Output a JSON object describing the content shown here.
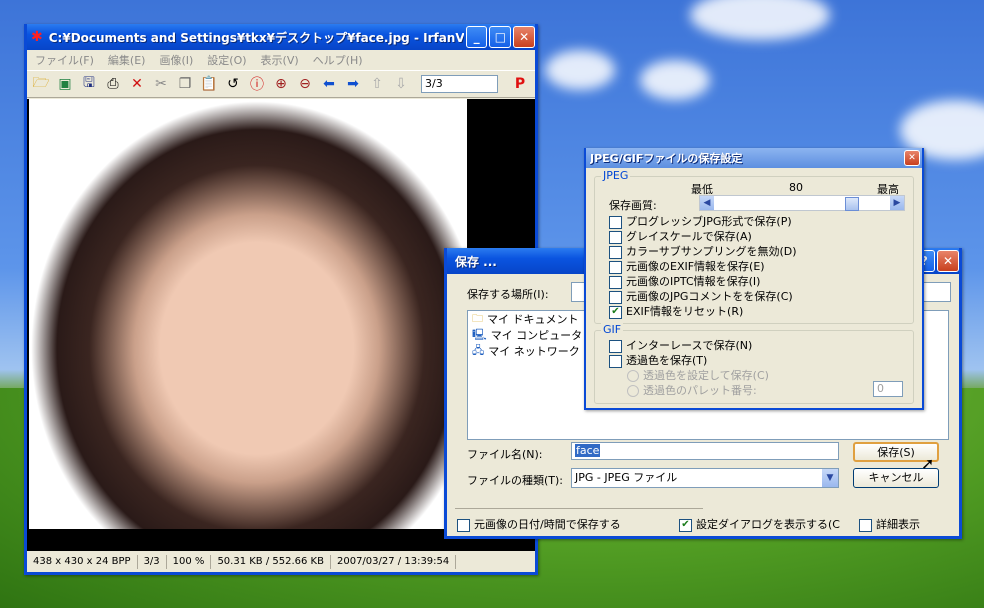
{
  "irfanview": {
    "title": "C:¥Documents and Settings¥tkx¥デスクトップ¥face.jpg - IrfanVi...",
    "menu": [
      "ファイル(F)",
      "編集(E)",
      "画像(I)",
      "設定(O)",
      "表示(V)",
      "ヘルプ(H)"
    ],
    "toolbar_icons": [
      "open-folder-icon",
      "slideshow-icon",
      "save-disk-icon",
      "print-icon",
      "delete-x-icon",
      "cut-icon",
      "copy-icon",
      "paste-icon",
      "undo-icon",
      "info-icon",
      "zoom-in-icon",
      "zoom-out-icon",
      "prev-arrow-icon",
      "next-arrow-icon",
      "first-page-icon",
      "last-page-icon"
    ],
    "page_value": "3/3",
    "paint_label": "P",
    "status": [
      "438 x 430 x 24 BPP",
      "3/3",
      "100 %",
      "50.31 KB / 552.66 KB",
      "2007/03/27 / 13:39:54"
    ]
  },
  "save_dialog": {
    "title": "保存 ...",
    "location_label": "保存する場所(I):",
    "locations": [
      "マイ ドキュメント",
      "マイ コンピュータ",
      "マイ ネットワーク"
    ],
    "filename_label": "ファイル名(N):",
    "filename_value": "face",
    "filetype_label": "ファイルの種類(T):",
    "filetype_value": "JPG - JPEG ファイル",
    "save_button": "保存(S)",
    "cancel_button": "キャンセル",
    "keep_date_label": "元画像の日付/時間で保存する",
    "show_settings_label": "設定ダイアログを表示する(C",
    "details_label": "詳細表示"
  },
  "jpeg_dialog": {
    "title": "JPEG/GIFファイルの保存設定",
    "jpeg_group": "JPEG",
    "min_label": "最低",
    "quality_value": "80",
    "max_label": "最高",
    "quality_label": "保存画質:",
    "quality_fraction": 0.8,
    "jpeg_options": [
      {
        "label": "プログレッシブJPG形式で保存(P)",
        "checked": false
      },
      {
        "label": "グレイスケールで保存(A)",
        "checked": false
      },
      {
        "label": "カラーサブサンプリングを無効(D)",
        "checked": false
      },
      {
        "label": "元画像のEXIF情報を保存(E)",
        "checked": false
      },
      {
        "label": "元画像のIPTC情報を保存(I)",
        "checked": false
      },
      {
        "label": "元画像のJPGコメントをを保存(C)",
        "checked": false
      },
      {
        "label": "EXIF情報をリセット(R)",
        "checked": true
      }
    ],
    "gif_group": "GIF",
    "gif_options": [
      {
        "label": "インターレースで保存(N)",
        "checked": false
      },
      {
        "label": "透過色を保存(T)",
        "checked": false
      }
    ],
    "radio_options": [
      "透過色を設定して保存(C)",
      "透過色のパレット番号:"
    ],
    "palette_value": "0"
  }
}
